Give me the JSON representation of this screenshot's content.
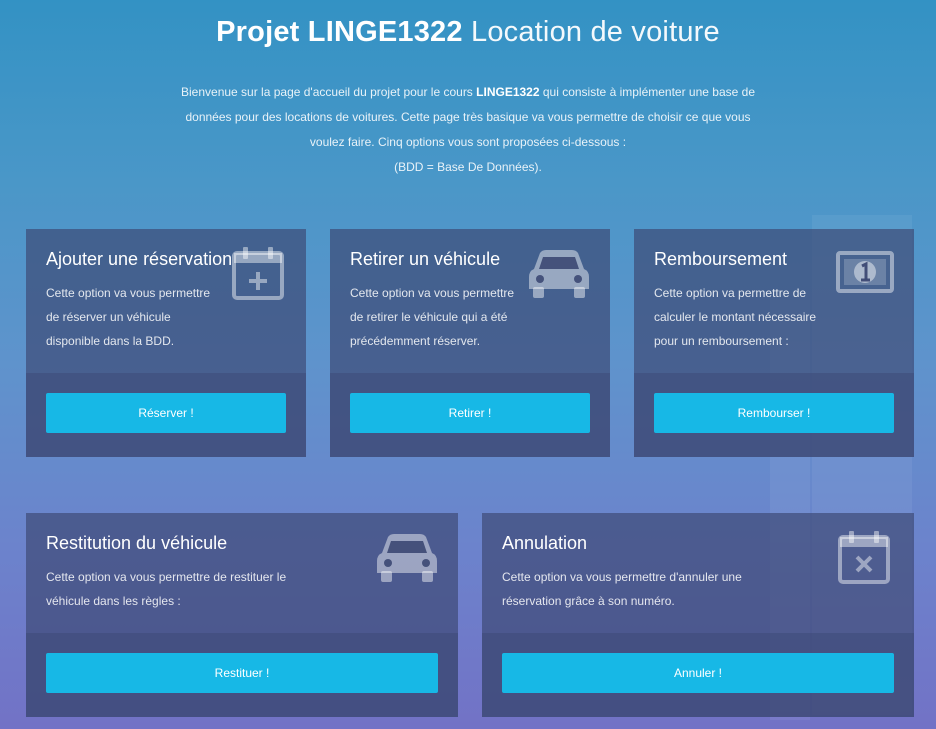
{
  "header": {
    "title_bold": "Projet LINGE1322",
    "title_light": "Location de voiture",
    "intro_1": "Bienvenue sur la page d'accueil du projet pour le cours ",
    "intro_course": "LINGE1322",
    "intro_2": " qui consiste à implémenter une base de",
    "intro_3": "données pour des locations de voitures. Cette page très basique va vous permettre de choisir ce que vous",
    "intro_4": "voulez faire. Cinq options vous sont proposées ci-dessous :",
    "intro_5": "(BDD = Base De Données)."
  },
  "cards": [
    {
      "title": "Ajouter une réservation",
      "lines": [
        "Cette option va vous permettre",
        "de réserver un véhicule",
        "disponible dans la BDD."
      ],
      "button": "Réserver !",
      "icon": "calendar-plus-icon"
    },
    {
      "title": "Retirer un véhicule",
      "lines": [
        "Cette option va vous permettre",
        "de retirer le véhicule qui a été",
        "précédemment réserver."
      ],
      "button": "Retirer !",
      "icon": "car-icon"
    },
    {
      "title": "Remboursement",
      "lines": [
        "Cette option va permettre de",
        "calculer le montant nécessaire",
        "pour un remboursement :"
      ],
      "button": "Rembourser !",
      "icon": "banknote-icon"
    },
    {
      "title": "Restitution du véhicule",
      "lines": [
        "Cette option va vous permettre de restituer le",
        "véhicule dans les règles :"
      ],
      "button": "Restituer !",
      "icon": "car-icon"
    },
    {
      "title": "Annulation",
      "lines": [
        "Cette option va vous permettre d'annuler une",
        "réservation grâce à son numéro."
      ],
      "button": "Annuler !",
      "icon": "calendar-x-icon"
    }
  ],
  "colors": {
    "button": "#17b8e6",
    "card": "#3c4873",
    "background_top": "#3392c4",
    "background_bottom": "#7272c6"
  }
}
